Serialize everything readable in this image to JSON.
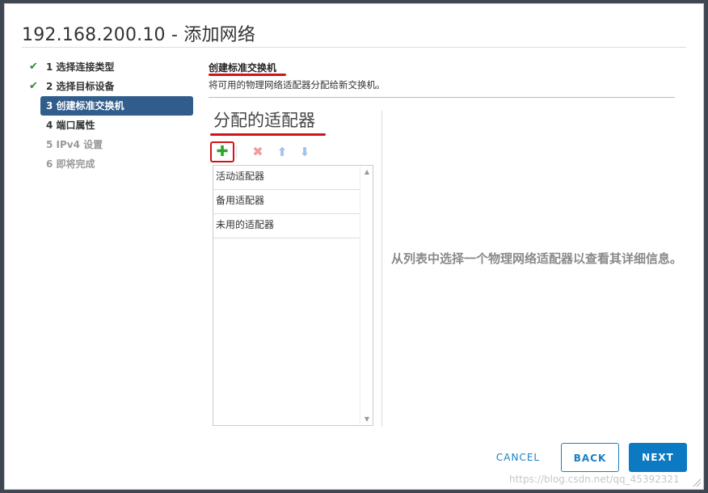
{
  "dialog": {
    "title": "192.168.200.10 - 添加网络"
  },
  "steps": [
    {
      "label": "1 选择连接类型",
      "state": "done"
    },
    {
      "label": "2 选择目标设备",
      "state": "done"
    },
    {
      "label": "3 创建标准交换机",
      "state": "active"
    },
    {
      "label": "4 端口属性",
      "state": "pending"
    },
    {
      "label": "5 IPv4 设置",
      "state": "disabled"
    },
    {
      "label": "6 即将完成",
      "state": "disabled"
    }
  ],
  "section": {
    "title": "创建标准交换机",
    "subtitle": "将可用的物理网络适配器分配给新交换机。"
  },
  "panel": {
    "title": "分配的适配器",
    "toolbar": {
      "add_icon": "plus-icon",
      "remove_icon": "x-icon",
      "up_icon": "arrow-up-icon",
      "down_icon": "arrow-down-icon"
    },
    "adapters": [
      "活动适配器",
      "备用适配器",
      "未用的适配器"
    ],
    "detail_message": "从列表中选择一个物理网络适配器以查看其详细信息。"
  },
  "footer": {
    "cancel_label": "CANCEL",
    "back_label": "BACK",
    "next_label": "NEXT"
  },
  "watermark": "https://blog.csdn.net/qq_45392321",
  "colors": {
    "accent": "#0c7ac2",
    "active_step": "#315d8c",
    "check": "#2f8a2f",
    "annotation": "#d21414"
  }
}
